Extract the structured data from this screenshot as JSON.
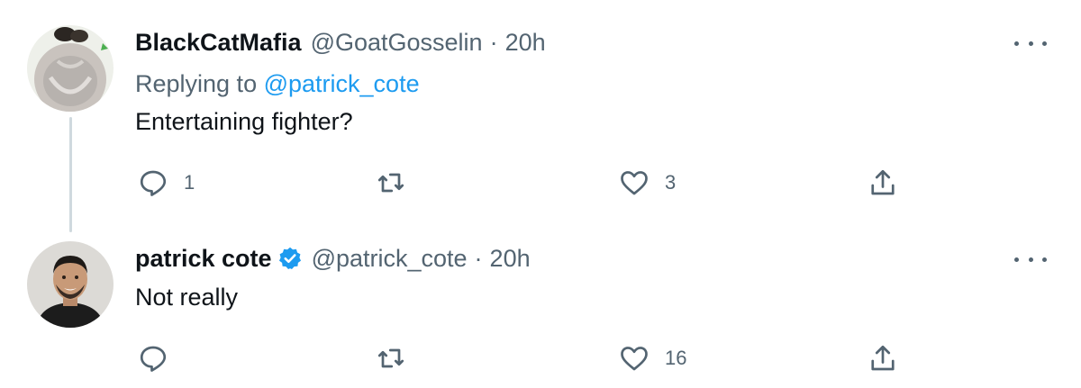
{
  "tweets": [
    {
      "display_name": "BlackCatMafia",
      "handle": "@GoatGosselin",
      "separator": "·",
      "time": "20h",
      "replying_prefix": "Replying to",
      "replying_handle": "@patrick_cote",
      "text": "Entertaining fighter?",
      "verified": false,
      "actions": {
        "reply_count": "1",
        "retweet_count": "",
        "like_count": "3"
      },
      "avatar_icon": "avatar-shaved-head-back"
    },
    {
      "display_name": "patrick cote",
      "handle": "@patrick_cote",
      "separator": "·",
      "time": "20h",
      "text": "Not really",
      "verified": true,
      "actions": {
        "reply_count": "",
        "retweet_count": "",
        "like_count": "16"
      },
      "avatar_icon": "avatar-smiling-man"
    }
  ],
  "colors": {
    "accent": "#1d9bf0",
    "secondary_text": "#536471",
    "primary_text": "#0f1419",
    "thread_line": "#cfd9de"
  }
}
